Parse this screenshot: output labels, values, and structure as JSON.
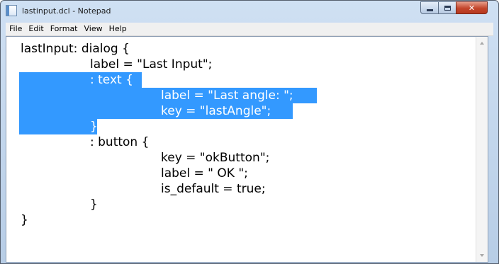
{
  "window": {
    "title": "lastinput.dcl - Notepad",
    "icon": "notepad-icon"
  },
  "menu": [
    "File",
    "Edit",
    "Format",
    "View",
    "Help"
  ],
  "editor": {
    "lines": [
      "lastInput: dialog {",
      "label = \"Last Input\";",
      ": text {",
      "label = \"Last angle: \";",
      "key = \"lastAngle\";",
      "}",
      ": button {",
      "key = \"okButton\";",
      "label = \" OK \";",
      "is_default = true;",
      "}",
      "}"
    ],
    "selection_color": "#3399ff"
  }
}
